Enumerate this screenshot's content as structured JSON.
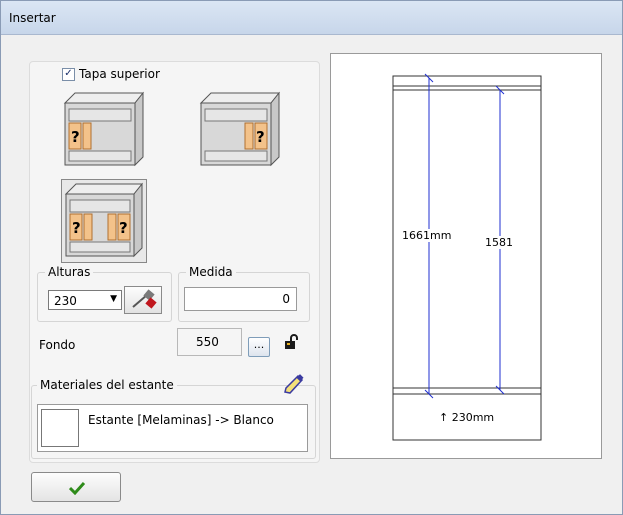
{
  "window": {
    "title": "Insertar"
  },
  "tapa_superior": {
    "label": "Tapa superior",
    "checked": true
  },
  "shelf_options": [
    {
      "name": "shelf-left",
      "selected": false
    },
    {
      "name": "shelf-right",
      "selected": false
    },
    {
      "name": "shelf-both",
      "selected": true
    }
  ],
  "alturas": {
    "legend": "Alturas",
    "value": "230",
    "picker_icon": "eyedropper-icon"
  },
  "medida": {
    "legend": "Medida",
    "value": "0"
  },
  "fondo": {
    "label": "Fondo",
    "value": "550",
    "browse_label": "...",
    "lock_icon": "unlocked-padlock-icon"
  },
  "materiales": {
    "legend": "Materiales del estante",
    "item": "Estante [Melaminas] -> Blanco",
    "swatch_color": "#ffffff",
    "picker_icon": "paint-tube-icon"
  },
  "ok_button": {
    "icon": "checkmark-icon",
    "color": "#2e8b1a"
  },
  "preview": {
    "dim_left": "1661mm",
    "dim_right": "1581",
    "dim_bottom": "↑ 230mm",
    "line_color": "#1f2fd0"
  }
}
